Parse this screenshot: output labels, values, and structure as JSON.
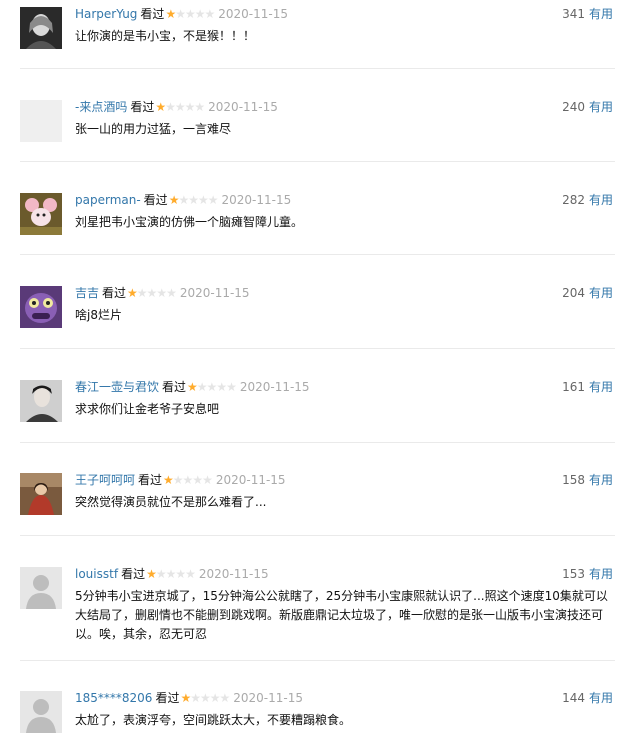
{
  "actions": {
    "watched_label": "看过",
    "useful_label": "有用"
  },
  "colors": {
    "link": "#3377aa",
    "star": "#ffac2d",
    "divider": "#eaeaea"
  },
  "comments": [
    {
      "user": "HarperYug",
      "rating_stars": 1,
      "date": "2020-11-15",
      "votes": "341",
      "text": "让你演的是韦小宝，不是猴！！！",
      "avatar_icon": "portrait-woman-avatar"
    },
    {
      "user": "-来点酒吗",
      "rating_stars": 1,
      "date": "2020-11-15",
      "votes": "240",
      "text": "张一山的用力过猛，一言难尽",
      "avatar_icon": "blank-avatar"
    },
    {
      "user": "paperman-",
      "rating_stars": 1,
      "date": "2020-11-15",
      "votes": "282",
      "text": "刘星把韦小宝演的仿佛一个脑瘫智障儿童。",
      "avatar_icon": "cartoon-mouse-avatar"
    },
    {
      "user": "吉吉",
      "rating_stars": 1,
      "date": "2020-11-15",
      "votes": "204",
      "text": "啥j8烂片",
      "avatar_icon": "purple-monster-avatar"
    },
    {
      "user": "春江一壶与君饮",
      "rating_stars": 1,
      "date": "2020-11-15",
      "votes": "161",
      "text": "求求你们让金老爷子安息吧",
      "avatar_icon": "portrait-man-avatar"
    },
    {
      "user": "王子呵呵呵",
      "rating_stars": 1,
      "date": "2020-11-15",
      "votes": "158",
      "text": "突然觉得演员就位不是那么难看了...",
      "avatar_icon": "red-figure-avatar"
    },
    {
      "user": "louisstf",
      "rating_stars": 1,
      "date": "2020-11-15",
      "votes": "153",
      "text": "5分钟韦小宝进京城了，15分钟海公公就瞎了，25分钟韦小宝康熙就认识了...照这个速度10集就可以大结局了，删剧情也不能删到跳戏啊。新版鹿鼎记太垃圾了，唯一欣慰的是张一山版韦小宝演技还可以。唉，其余，忍无可忍",
      "avatar_icon": "default-user-avatar"
    },
    {
      "user": "185****8206",
      "rating_stars": 1,
      "date": "2020-11-15",
      "votes": "144",
      "text": "太尬了，表演浮夸，空间跳跃太大，不要糟蹋粮食。",
      "avatar_icon": "default-user-avatar"
    }
  ]
}
